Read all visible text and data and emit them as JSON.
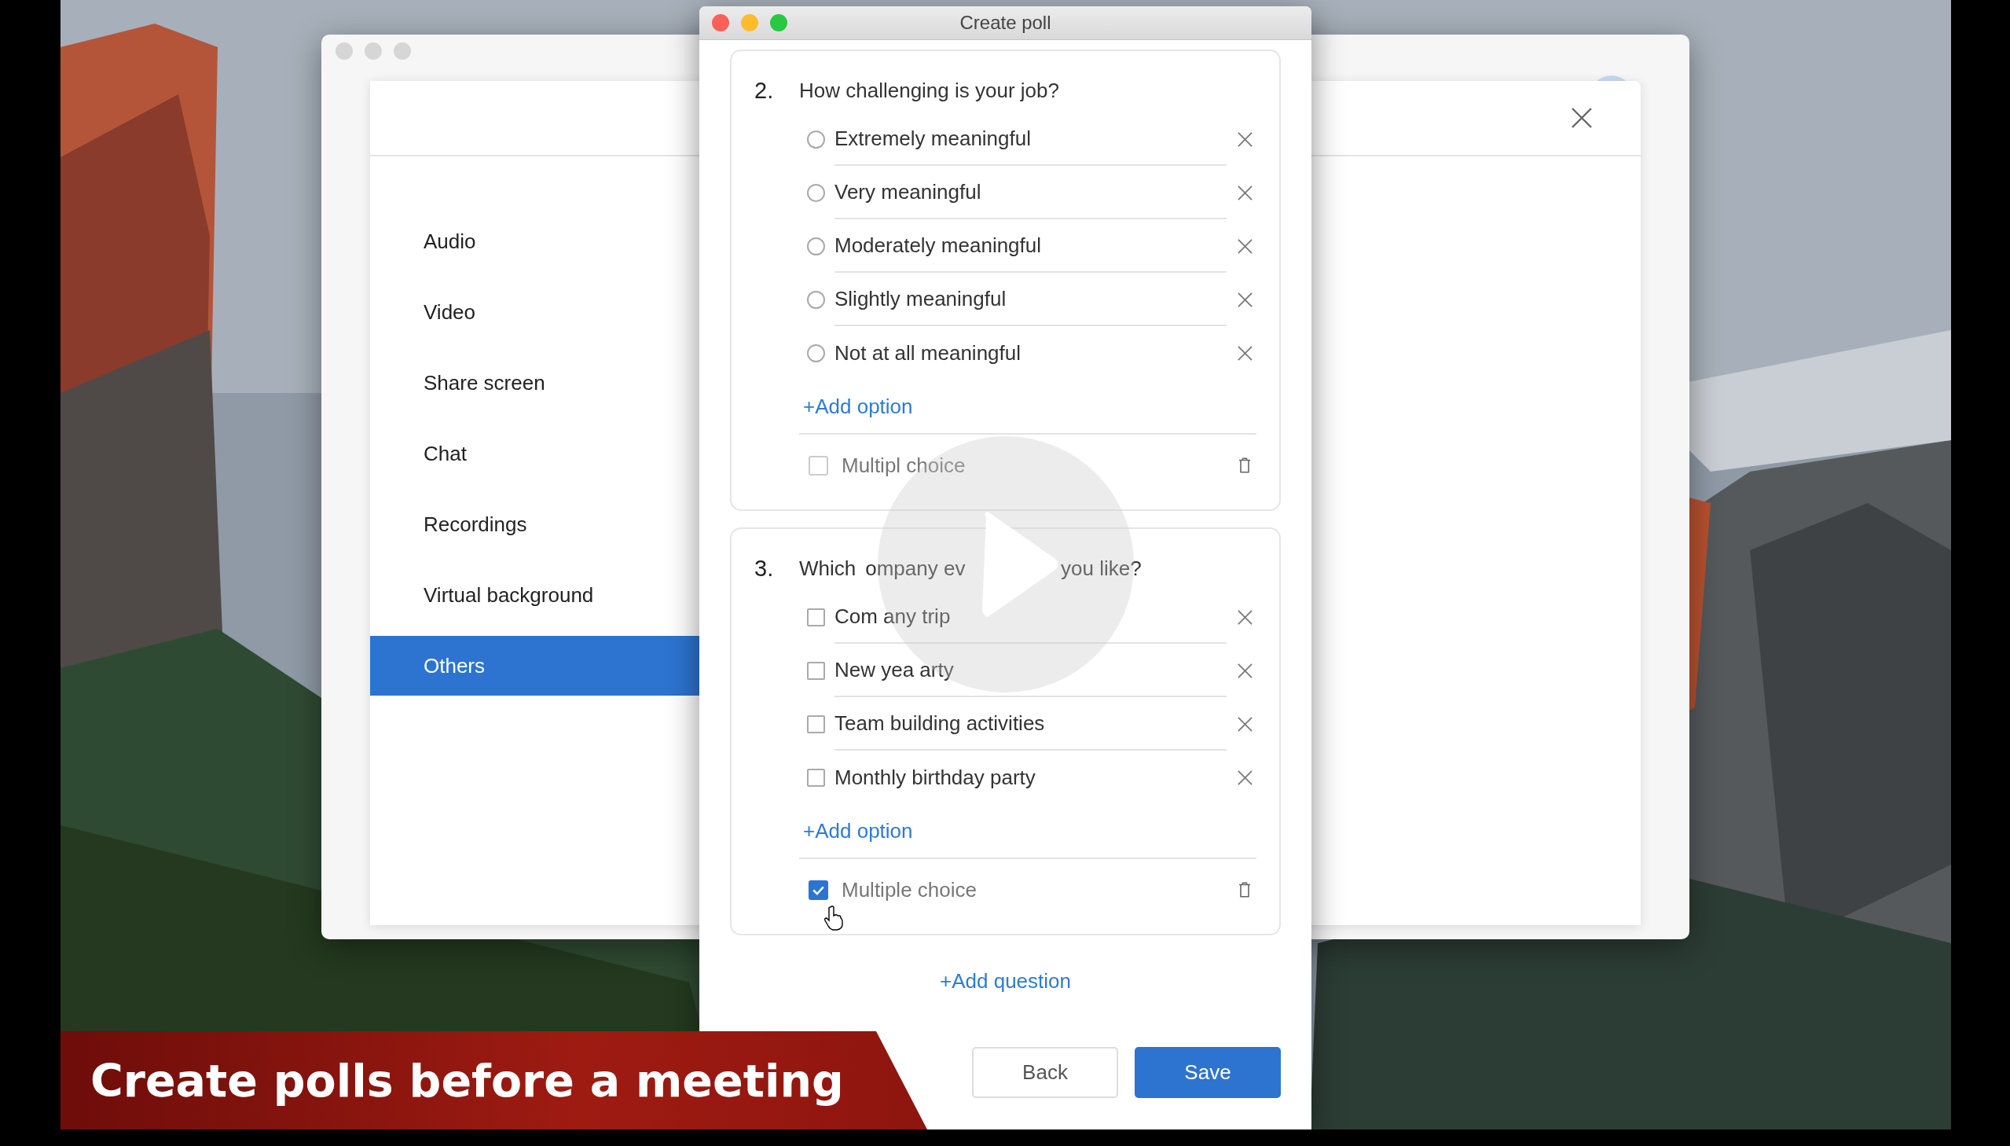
{
  "settings_window": {
    "sidebar": {
      "items": [
        {
          "label": "Audio",
          "selected": false
        },
        {
          "label": "Video",
          "selected": false
        },
        {
          "label": "Share screen",
          "selected": false
        },
        {
          "label": "Chat",
          "selected": false
        },
        {
          "label": "Recordings",
          "selected": false
        },
        {
          "label": "Virtual background",
          "selected": false
        },
        {
          "label": "Others",
          "selected": true
        }
      ]
    }
  },
  "dialog": {
    "title": "Create poll",
    "questions": [
      {
        "number": "2.",
        "title_parts": [
          "How challenging is your job?"
        ],
        "kind": "single",
        "options": [
          {
            "label_parts": [
              "Extremely meaningful"
            ],
            "checked": false
          },
          {
            "label_parts": [
              "Very meaningful"
            ],
            "checked": false
          },
          {
            "label_parts": [
              "Moderately meaningful"
            ],
            "checked": false
          },
          {
            "label_parts": [
              "Slightly meaningful"
            ],
            "checked": false
          },
          {
            "label_parts": [
              "Not at all meaningful"
            ],
            "checked": false
          }
        ],
        "add_option": "+Add option",
        "multiple_choice": {
          "label_parts": [
            "Multipl",
            "choice"
          ],
          "checked": false
        }
      },
      {
        "number": "3.",
        "title_parts": [
          "Which",
          "ompany ev",
          "you like?"
        ],
        "kind": "multi",
        "options": [
          {
            "label_parts": [
              "Com",
              "any trip"
            ],
            "checked": false
          },
          {
            "label_parts": [
              "New yea",
              "arty"
            ],
            "checked": false
          },
          {
            "label_parts": [
              "Team building activities"
            ],
            "checked": false
          },
          {
            "label_parts": [
              "Monthly birthday party"
            ],
            "checked": false
          }
        ],
        "add_option": "+Add option",
        "multiple_choice": {
          "label_parts": [
            "Multiple choice"
          ],
          "checked": true
        }
      }
    ],
    "add_question": "+Add question",
    "buttons": [
      {
        "label": "Back",
        "kind": "secondary"
      },
      {
        "label": "Save",
        "kind": "primary"
      }
    ]
  },
  "banner": {
    "text": "Create polls before a meeting"
  }
}
